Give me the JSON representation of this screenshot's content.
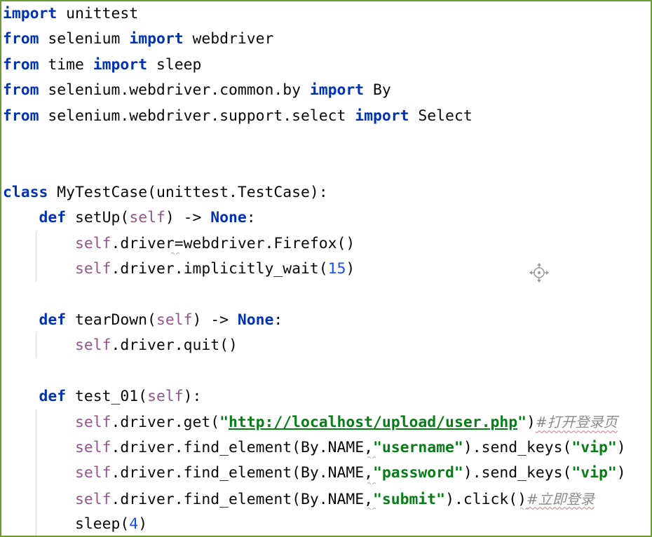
{
  "editor": {
    "lines": [
      [
        {
          "t": "import",
          "c": "kw"
        },
        {
          "t": " unittest"
        }
      ],
      [
        {
          "t": "from",
          "c": "kw"
        },
        {
          "t": " selenium "
        },
        {
          "t": "import",
          "c": "kw"
        },
        {
          "t": " webdriver"
        }
      ],
      [
        {
          "t": "from",
          "c": "kw"
        },
        {
          "t": " time "
        },
        {
          "t": "import",
          "c": "kw"
        },
        {
          "t": " sleep"
        }
      ],
      [
        {
          "t": "from",
          "c": "kw"
        },
        {
          "t": " selenium.webdriver.common.by "
        },
        {
          "t": "import",
          "c": "kw"
        },
        {
          "t": " By"
        }
      ],
      [
        {
          "t": "from",
          "c": "kw"
        },
        {
          "t": " selenium.webdriver.support.select "
        },
        {
          "t": "import",
          "c": "kw"
        },
        {
          "t": " Select"
        }
      ],
      [],
      [],
      [
        {
          "t": "class",
          "c": "kw"
        },
        {
          "t": " MyTestCase(unittest.TestCase):"
        }
      ],
      [
        {
          "t": "    "
        },
        {
          "t": "def",
          "c": "kw"
        },
        {
          "t": " setUp("
        },
        {
          "t": "self",
          "c": "self"
        },
        {
          "t": ") -> "
        },
        {
          "t": "None",
          "c": "kw"
        },
        {
          "t": ":"
        }
      ],
      [
        {
          "t": "        "
        },
        {
          "t": "self",
          "c": "self"
        },
        {
          "t": ".driver=webdriver.Firefox()"
        }
      ],
      [
        {
          "t": "        "
        },
        {
          "t": "self",
          "c": "self"
        },
        {
          "t": ".driver.implicitly_wait("
        },
        {
          "t": "15",
          "c": "num"
        },
        {
          "t": ")"
        }
      ],
      [],
      [
        {
          "t": "    "
        },
        {
          "t": "def",
          "c": "kw"
        },
        {
          "t": " tearDown("
        },
        {
          "t": "self",
          "c": "self"
        },
        {
          "t": ") -> "
        },
        {
          "t": "None",
          "c": "kw"
        },
        {
          "t": ":"
        }
      ],
      [
        {
          "t": "        "
        },
        {
          "t": "self",
          "c": "self"
        },
        {
          "t": ".driver.quit()"
        }
      ],
      [],
      [
        {
          "t": "    "
        },
        {
          "t": "def",
          "c": "kw"
        },
        {
          "t": " test_01("
        },
        {
          "t": "self",
          "c": "self"
        },
        {
          "t": "):"
        }
      ],
      [
        {
          "t": "        "
        },
        {
          "t": "self",
          "c": "self"
        },
        {
          "t": ".driver.get("
        },
        {
          "t": "\"",
          "c": "str"
        },
        {
          "t": "http://localhost/upload/user.php",
          "c": "str url"
        },
        {
          "t": "\"",
          "c": "str"
        },
        {
          "t": ")"
        },
        {
          "t": "#打开登录页",
          "c": "cmt cmt-typo"
        }
      ],
      [
        {
          "t": "        "
        },
        {
          "t": "self",
          "c": "self"
        },
        {
          "t": ".driver.find_element(By.NAME,"
        },
        {
          "t": "\"username\"",
          "c": "str"
        },
        {
          "t": ").send_keys("
        },
        {
          "t": "\"vip\"",
          "c": "str"
        },
        {
          "t": ")"
        }
      ],
      [
        {
          "t": "        "
        },
        {
          "t": "self",
          "c": "self"
        },
        {
          "t": ".driver.find_element(By.NAME,"
        },
        {
          "t": "\"password\"",
          "c": "str"
        },
        {
          "t": ").send_keys("
        },
        {
          "t": "\"vip\"",
          "c": "str"
        },
        {
          "t": ")"
        }
      ],
      [
        {
          "t": "        "
        },
        {
          "t": "self",
          "c": "self"
        },
        {
          "t": ".driver.find_element(By.NAME,"
        },
        {
          "t": "\"submit\"",
          "c": "str"
        },
        {
          "t": ").click()"
        },
        {
          "t": "#立即登录",
          "c": "cmt cmt-typo"
        }
      ],
      [
        {
          "t": "        sleep("
        },
        {
          "t": "4",
          "c": "num"
        },
        {
          "t": ")"
        }
      ]
    ]
  },
  "colors": {
    "keyword": "#0033b3",
    "self": "#94558d",
    "number": "#1750eb",
    "string": "#067d17",
    "comment": "#8c8c8c",
    "frame": "#6f9a3a"
  },
  "icons": {
    "cursor": "move-crosshair-icon"
  }
}
